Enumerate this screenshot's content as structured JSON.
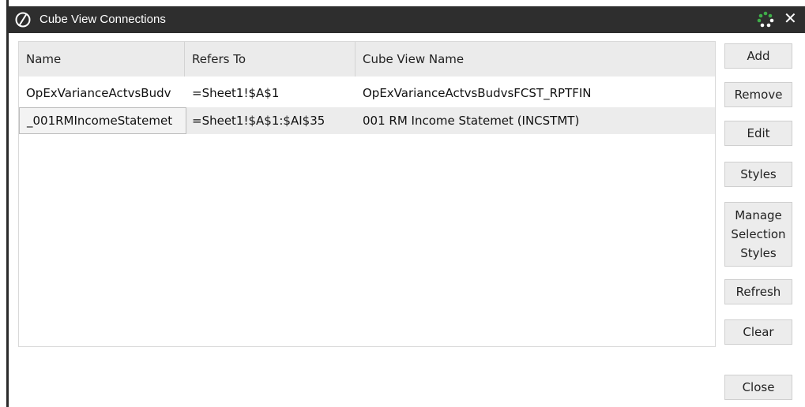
{
  "window": {
    "title": "Cube View Connections",
    "close_label": "✕"
  },
  "grid": {
    "columns": [
      "Name",
      "Refers To",
      "Cube View Name"
    ],
    "rows": [
      {
        "name": "OpExVarianceActvsBudv",
        "refers_to": "=Sheet1!$A$1",
        "cube_view_name": "OpExVarianceActvsBudvsFCST_RPTFIN"
      },
      {
        "name": "_001RMIncomeStatemet",
        "refers_to": "=Sheet1!$A$1:$AI$35",
        "cube_view_name": "001 RM Income Statemet (INCSTMT)"
      }
    ]
  },
  "buttons": {
    "add": "Add",
    "remove": "Remove",
    "edit": "Edit",
    "styles": "Styles",
    "manage_selection_styles": "Manage\nSelection\nStyles",
    "refresh": "Refresh",
    "clear": "Clear",
    "close": "Close"
  },
  "colors": {
    "titlebar": "#2e2e2e",
    "spinner_green": "#3fae49"
  }
}
